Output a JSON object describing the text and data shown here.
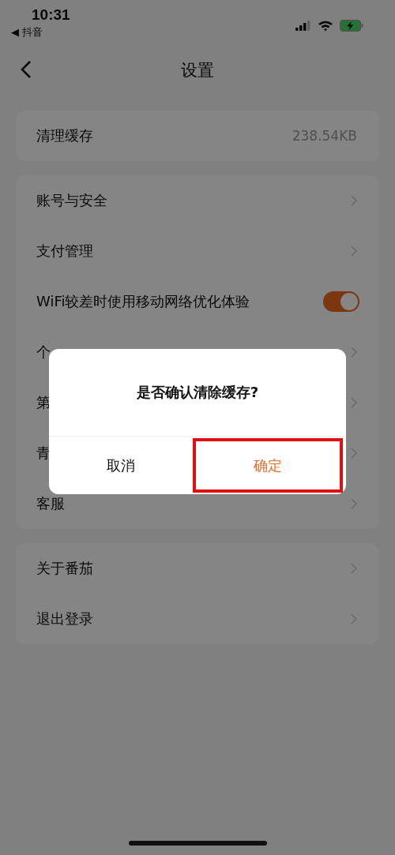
{
  "status_bar": {
    "time": "10:31",
    "back_app": "◀ 抖音"
  },
  "nav": {
    "title": "设置"
  },
  "cache": {
    "label": "清理缓存",
    "value": "238.54KB"
  },
  "groups": [
    {
      "rows": [
        {
          "label": "账号与安全",
          "kind": "link"
        },
        {
          "label": "支付管理",
          "kind": "link"
        },
        {
          "label": "WiFi较差时使用移动网络优化体验",
          "kind": "toggle",
          "on": true
        },
        {
          "label": "个",
          "kind": "link"
        },
        {
          "label": "第",
          "kind": "link"
        },
        {
          "label": "青",
          "kind": "link"
        },
        {
          "label": "客服",
          "kind": "link"
        }
      ]
    },
    {
      "rows": [
        {
          "label": "关于番茄",
          "kind": "link"
        },
        {
          "label": "退出登录",
          "kind": "link"
        }
      ]
    }
  ],
  "dialog": {
    "message": "是否确认清除缓存?",
    "buttons": [
      {
        "label": "取消",
        "kind": "cancel"
      },
      {
        "label": "确定",
        "kind": "confirm",
        "highlighted": true
      }
    ]
  }
}
